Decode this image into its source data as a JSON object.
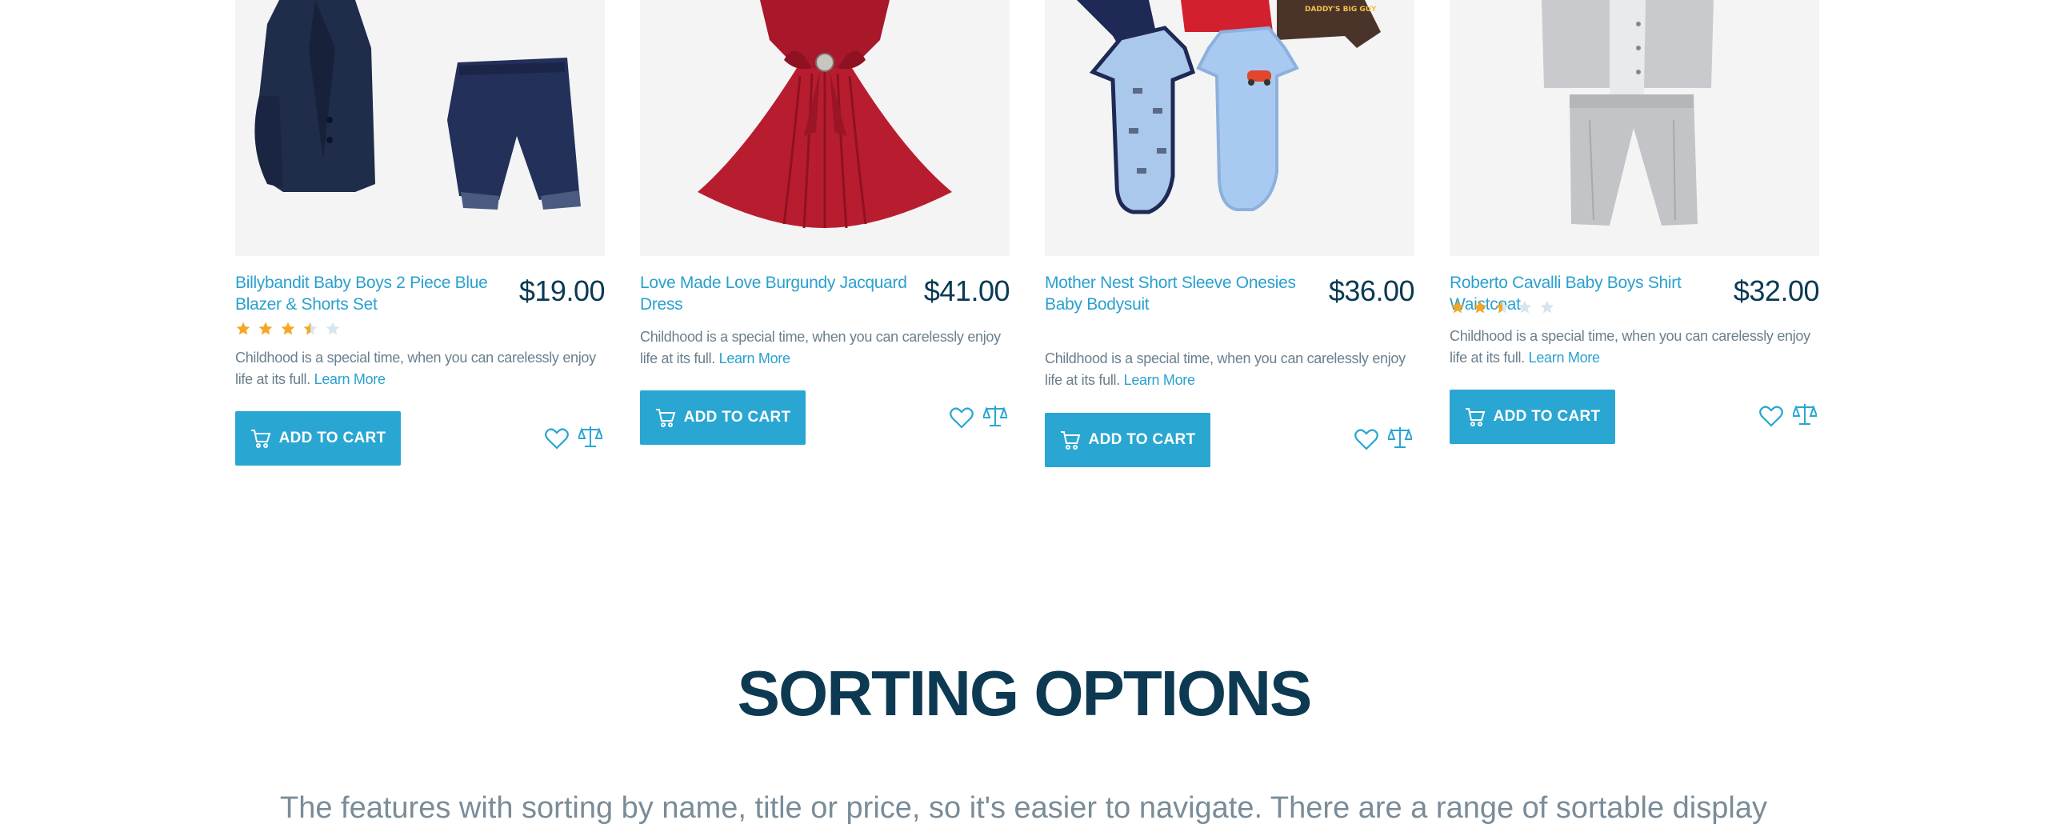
{
  "colors": {
    "accent": "#2aa6d2",
    "link": "#2aa0cf",
    "price": "#0a3a54",
    "heading": "#0d3a52",
    "body_text": "#6a7f8d",
    "star_filled": "#f5a623",
    "star_empty": "#d6e6ee",
    "image_bg": "#f4f4f5"
  },
  "products": [
    {
      "title": "Billybandit Baby Boys 2 Piece Blue Blazer & Shorts Set",
      "price": "$19.00",
      "rating": 3.5,
      "rating_max": 5,
      "description": "Childhood is a special time, when you can carelessly enjoy life at its full.",
      "learn_more": "Learn More",
      "add_to_cart": "ADD TO CART",
      "image_icon": "blazer-shorts-set-image"
    },
    {
      "title": "Love Made Love Burgundy Jacquard Dress",
      "price": "$41.00",
      "rating": null,
      "description": "Childhood is a special time, when you can carelessly enjoy life at its full.",
      "learn_more": "Learn More",
      "add_to_cart": "ADD TO CART",
      "image_icon": "burgundy-dress-image"
    },
    {
      "title": "Mother Nest Short Sleeve Onesies Baby Bodysuit",
      "price": "$36.00",
      "rating": null,
      "description": "Childhood is a special time, when you can carelessly enjoy life at its full.",
      "learn_more": "Learn More",
      "add_to_cart": "ADD TO CART",
      "image_icon": "onesies-bodysuit-image",
      "image_text": "DADDY'S BIG GUY"
    },
    {
      "title": "Roberto Cavalli Baby Boys Shirt Waistcoat",
      "price": "$32.00",
      "rating": 2.5,
      "rating_max": 5,
      "description": "Childhood is a special time, when you can carelessly enjoy life at its full.",
      "learn_more": "Learn More",
      "add_to_cart": "ADD TO CART",
      "image_icon": "shirt-waistcoat-image"
    }
  ],
  "icons": {
    "cart": "cart-icon",
    "wishlist": "heart-icon",
    "compare": "scales-icon",
    "star": "star-icon"
  },
  "section": {
    "title": "SORTING OPTIONS",
    "intro": "The features with sorting by name, title or price, so it's easier to navigate. There are a range of sortable display solutions to make sure..."
  }
}
